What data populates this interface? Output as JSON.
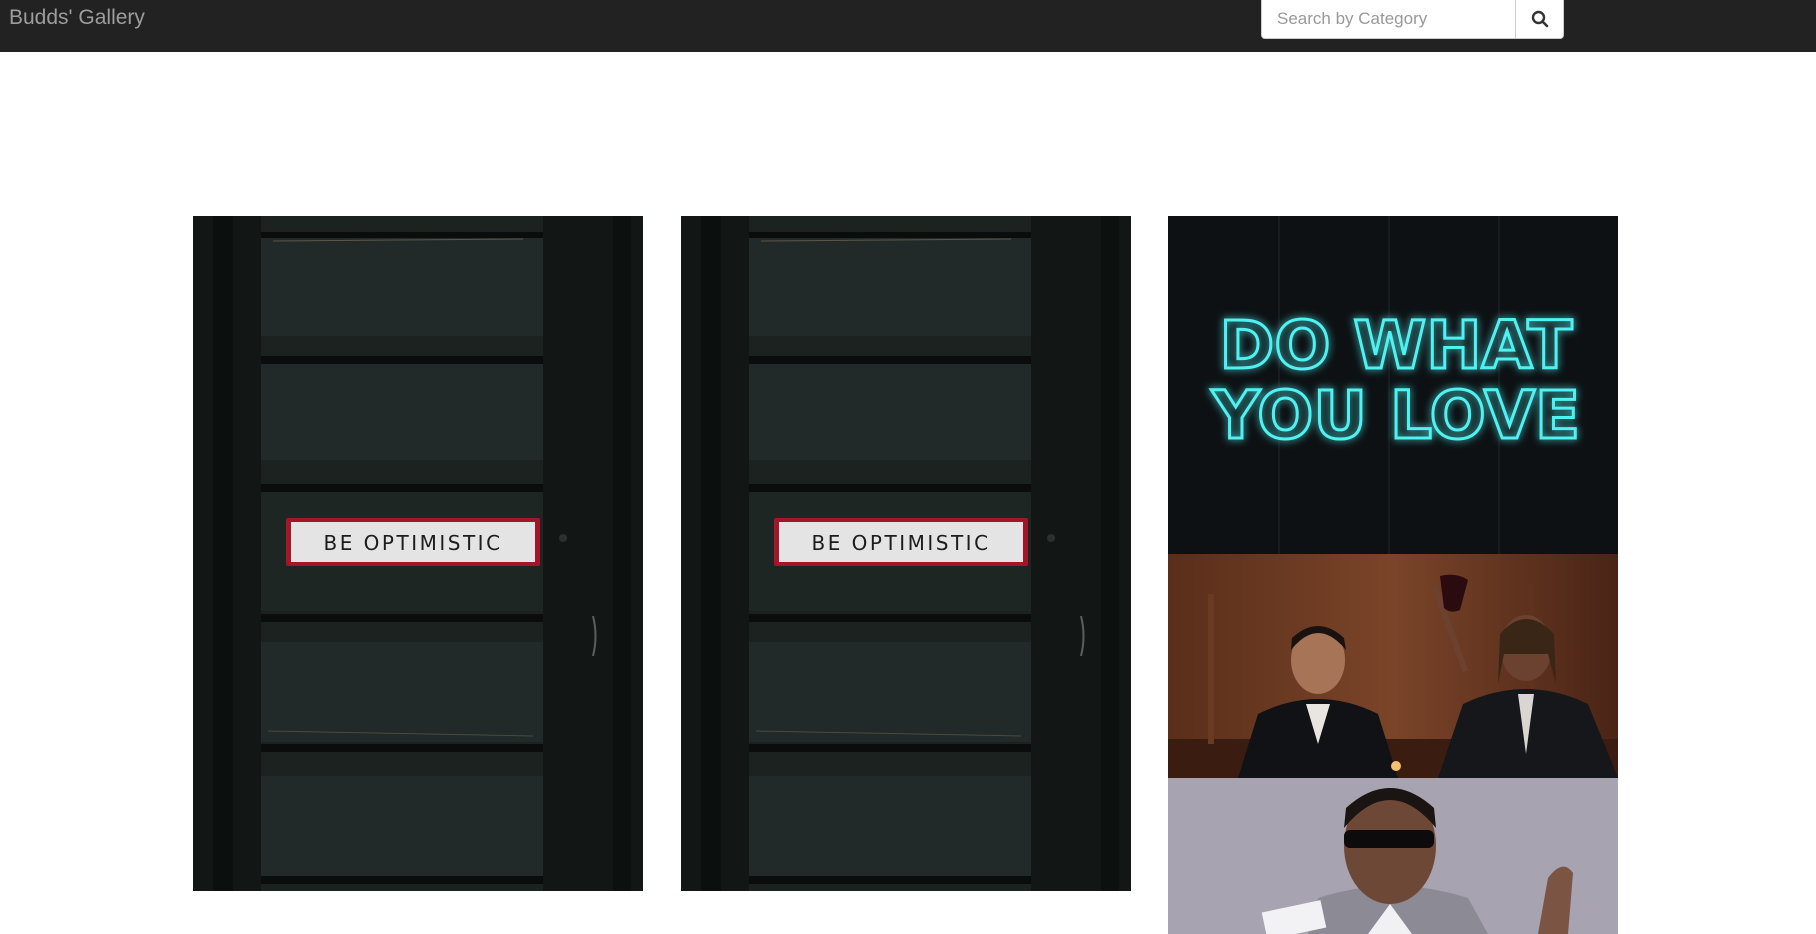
{
  "navbar": {
    "brand": "Budds' Gallery",
    "search": {
      "placeholder": "Search by Category",
      "value": ""
    },
    "search_icon": "search-icon"
  },
  "gallery": {
    "photos": [
      {
        "subject": "door-sign",
        "sign_text": "BE OPTIMISTIC"
      },
      {
        "subject": "door-sign",
        "sign_text": "BE OPTIMISTIC"
      },
      {
        "subject": "neon-sign",
        "neon_lines": [
          "DO WHAT",
          "YOU LOVE"
        ],
        "neon_color": "#4ff2f2"
      },
      {
        "subject": "two-men-toasting"
      },
      {
        "subject": "man-in-sunglasses"
      }
    ]
  },
  "colors": {
    "navbar_bg": "#222222",
    "brand_text": "#9d9d9d",
    "page_bg": "#ffffff"
  }
}
